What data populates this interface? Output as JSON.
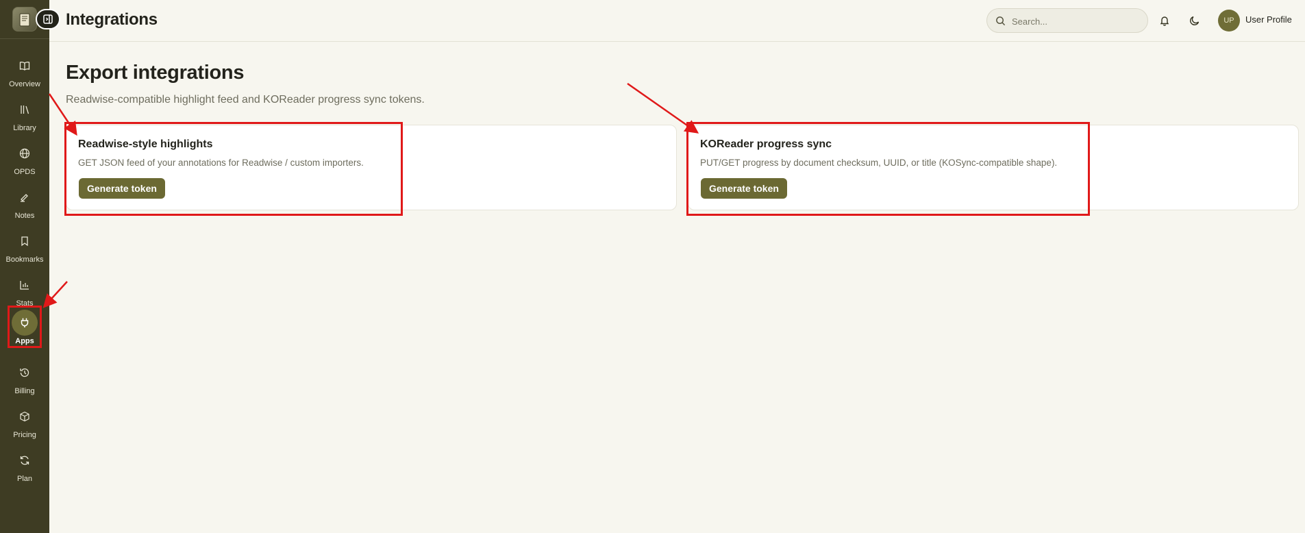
{
  "header": {
    "title": "Integrations",
    "search_placeholder": "Search...",
    "notification_icon": "bell-icon",
    "theme_icon": "moon-icon",
    "avatar_initials": "UP",
    "profile_name": "User Profile"
  },
  "sidebar": {
    "logo_icon": "book-logo-icon",
    "collapse_icon": "sidebar-collapse-icon",
    "items": [
      {
        "label": "Overview",
        "icon": "book-open-icon",
        "active": false
      },
      {
        "label": "Library",
        "icon": "library-icon",
        "active": false
      },
      {
        "label": "OPDS",
        "icon": "globe-icon",
        "active": false
      },
      {
        "label": "Notes",
        "icon": "pen-icon",
        "active": false
      },
      {
        "label": "Bookmarks",
        "icon": "bookmark-icon",
        "active": false
      },
      {
        "label": "Stats",
        "icon": "bar-chart-icon",
        "active": false
      },
      {
        "label": "Apps",
        "icon": "plug-icon",
        "active": true
      },
      {
        "label": "Billing",
        "icon": "history-icon",
        "active": false
      },
      {
        "label": "Pricing",
        "icon": "box-icon",
        "active": false
      },
      {
        "label": "Plan",
        "icon": "refresh-icon",
        "active": false
      }
    ]
  },
  "main": {
    "section_title": "Export integrations",
    "section_subtitle": "Readwise-compatible highlight feed and KOReader progress sync tokens.",
    "cards": [
      {
        "title": "Readwise-style highlights",
        "description": "GET JSON feed of your annotations for Readwise / custom importers.",
        "button_label": "Generate token"
      },
      {
        "title": "KOReader progress sync",
        "description": "PUT/GET progress by document checksum, UUID, or title (KOSync-compatible shape).",
        "button_label": "Generate token"
      }
    ]
  },
  "colors": {
    "sidebar_bg": "#3e3c23",
    "accent": "#6b6933",
    "page_bg": "#f7f6ef",
    "annotation": "#e01919"
  }
}
